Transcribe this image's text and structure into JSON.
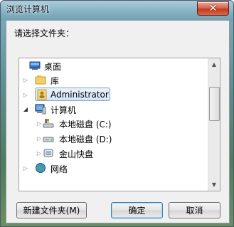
{
  "window": {
    "title": "浏览计算机",
    "close_label": "✕"
  },
  "prompt": "请选择文件夹：",
  "tree": {
    "items": [
      {
        "label": "桌面",
        "icon": "desktop-icon",
        "expander": ""
      },
      {
        "label": "库",
        "icon": "library-icon",
        "expander": "▷"
      },
      {
        "label": "Administrator",
        "icon": "user-folder-icon",
        "expander": "▷",
        "selected": true
      },
      {
        "label": "计算机",
        "icon": "computer-icon",
        "expander": "◢"
      },
      {
        "label": "本地磁盘 (C:)",
        "icon": "system-drive-icon",
        "expander": "▷"
      },
      {
        "label": "本地磁盘 (D:)",
        "icon": "drive-icon",
        "expander": "▷"
      },
      {
        "label": "金山快盘",
        "icon": "cloud-drive-icon",
        "expander": "▷"
      },
      {
        "label": "网络",
        "icon": "network-icon",
        "expander": "▷"
      }
    ]
  },
  "scrollbar": {
    "up": "▲",
    "down": "▼"
  },
  "buttons": {
    "new_folder": "新建文件夹(M)",
    "ok": "确定",
    "cancel": "取消"
  },
  "colors": {
    "selection_fill": "#d5e6fa",
    "selection_border": "#7da2ce",
    "close_red": "#c3381f"
  }
}
